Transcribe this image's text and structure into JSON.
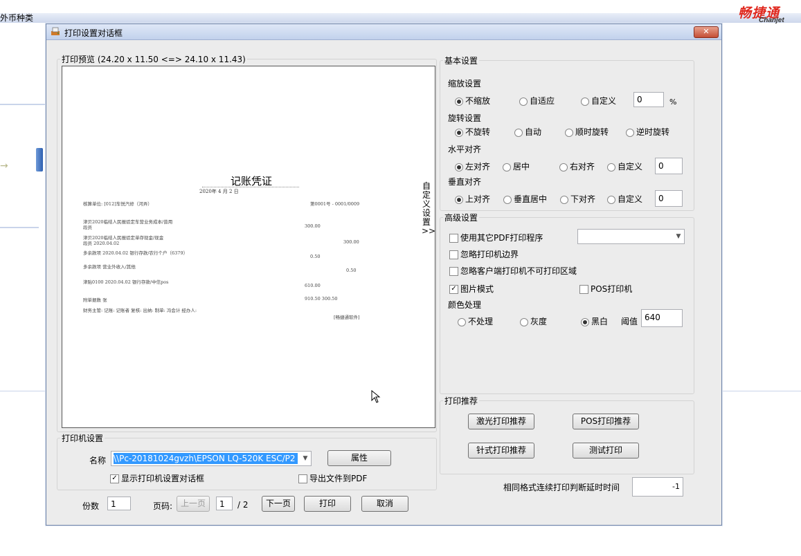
{
  "background": {
    "menu_text": "外币种类",
    "logo_cn": "畅捷通",
    "logo_en": "Chanjet",
    "arrow": "→"
  },
  "dialog": {
    "title": "打印设置对话框",
    "close_label": "✕"
  },
  "preview": {
    "legend": "打印预览 (24.20 x 11.50 <=> 24.10 x 11.43)",
    "voucher": {
      "title": "记账凭证",
      "date": "2020年 4 月 2 日",
      "unit": "核算单位: [012]车悦汽修（河弄）",
      "number": "第0001号 - 0001/0009",
      "lines": [
        {
          "text": "津贝2020临结人民报验定车营业务成本/普用",
          "amount": ""
        },
        {
          "text": "段员",
          "amount": "300.00"
        },
        {
          "text": "津贝2020临结人民报验定单存现金/现金",
          "amount": ""
        },
        {
          "text": "段员   2020.04.02",
          "amount": "300.00"
        },
        {
          "text": "多余款项   2020.04.02 银行存款/农行个户（6379）",
          "amount": "0.50"
        },
        {
          "text": "多余款项              营业外收入/其他",
          "amount": "0.50"
        },
        {
          "text": "津贴0100   2020.04.02 银行存款/中信pos",
          "amount": "610.00"
        },
        {
          "text": "附单据数          张",
          "amount": "910.50   300.50"
        }
      ],
      "footer": "财务主管:          记账: 记账者      复核:            出纳:            制单: 冯会计   经办人:",
      "footer_note": "[畅捷通软件]"
    }
  },
  "custom_tab": {
    "label": "自定义设置",
    "arrows": ">>"
  },
  "printer": {
    "legend": "打印机设置",
    "name_label": "名称",
    "name_value": "\\\\Pc-20181024gvzh\\EPSON LQ-520K ESC/P2",
    "properties_button": "属性",
    "show_dialog_label": "显示打印机设置对话框",
    "show_dialog_checked": true,
    "export_pdf_label": "导出文件到PDF",
    "export_pdf_checked": false
  },
  "bottom": {
    "copies_label": "份数",
    "copies_value": "1",
    "page_label": "页码:",
    "prev_button": "上一页",
    "page_value": "1",
    "total_pages": "/ 2",
    "next_button": "下一页",
    "print_button": "打印",
    "cancel_button": "取消"
  },
  "basic": {
    "legend": "基本设置",
    "scale_title": "缩放设置",
    "scale_options": [
      "不缩放",
      "自适应",
      "自定义"
    ],
    "scale_selected": "不缩放",
    "scale_value": "0",
    "scale_unit": "%",
    "rotate_title": "旋转设置",
    "rotate_options": [
      "不旋转",
      "自动",
      "顺时旋转",
      "逆时旋转"
    ],
    "rotate_selected": "不旋转",
    "halign_title": "水平对齐",
    "halign_options": [
      "左对齐",
      "居中",
      "右对齐",
      "自定义"
    ],
    "halign_selected": "左对齐",
    "halign_value": "0",
    "valign_title": "垂直对齐",
    "valign_options": [
      "上对齐",
      "垂直居中",
      "下对齐",
      "自定义"
    ],
    "valign_selected": "上对齐",
    "valign_value": "0"
  },
  "advanced": {
    "legend": "高级设置",
    "use_pdf_label": "使用其它PDF打印程序",
    "use_pdf_checked": false,
    "ignore_margin_label": "忽略打印机边界",
    "ignore_margin_checked": false,
    "ignore_area_label": "忽略客户端打印机不可打印区域",
    "ignore_area_checked": false,
    "image_mode_label": "图片模式",
    "image_mode_checked": true,
    "pos_label": "POS打印机",
    "pos_checked": false,
    "color_title": "颜色处理",
    "color_options": [
      "不处理",
      "灰度",
      "黑白"
    ],
    "color_selected": "黑白",
    "threshold_label": "阈值",
    "threshold_value": "640"
  },
  "recommend": {
    "legend": "打印推荐",
    "laser_button": "激光打印推荐",
    "pos_button": "POS打印推荐",
    "dot_button": "针式打印推荐",
    "test_button": "测试打印"
  },
  "delay": {
    "label": "相同格式连续打印判断延时时间",
    "value": "-1"
  }
}
